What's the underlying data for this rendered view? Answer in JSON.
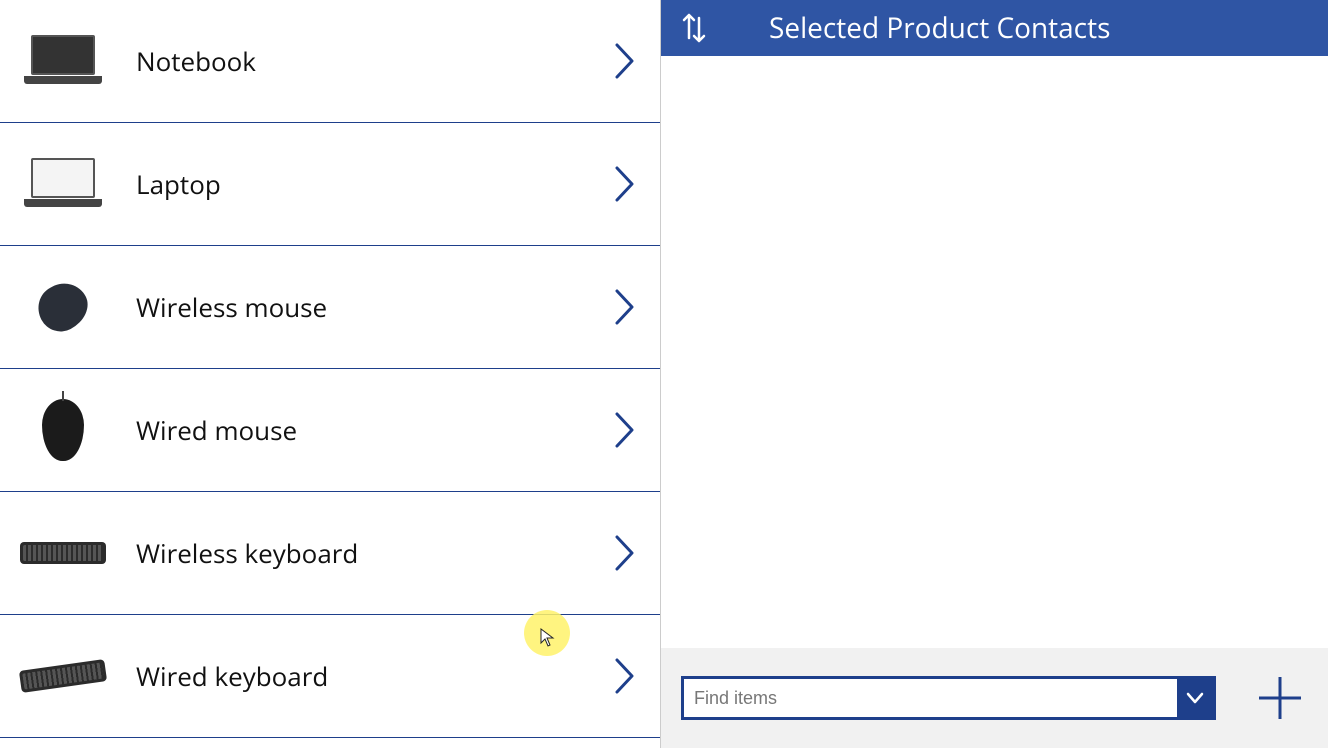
{
  "colors": {
    "accent": "#1e3f8b",
    "header": "#2f55a4"
  },
  "left": {
    "products": [
      {
        "label": "Notebook",
        "thumb": "notebook"
      },
      {
        "label": "Laptop",
        "thumb": "laptop"
      },
      {
        "label": "Wireless mouse",
        "thumb": "wmouse"
      },
      {
        "label": "Wired mouse",
        "thumb": "wiredmouse"
      },
      {
        "label": "Wireless keyboard",
        "thumb": "wkeyboard"
      },
      {
        "label": "Wired keyboard",
        "thumb": "wiredkeyboard"
      }
    ]
  },
  "right": {
    "title": "Selected Product Contacts",
    "find_placeholder": "Find items"
  }
}
